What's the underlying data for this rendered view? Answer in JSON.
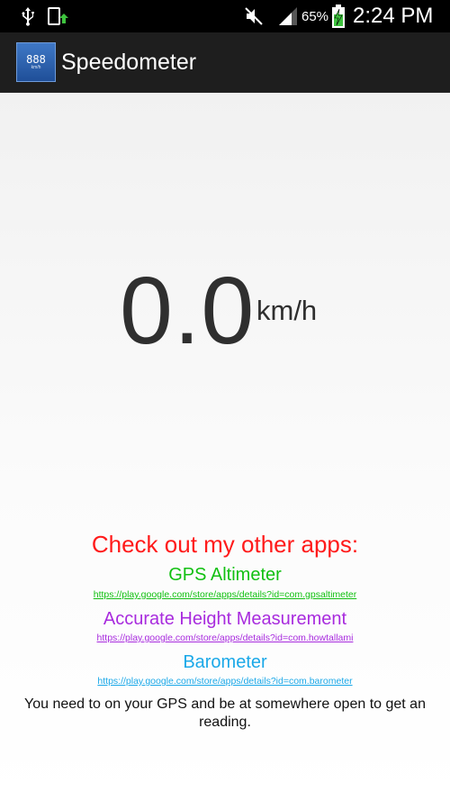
{
  "status_bar": {
    "battery": "65%",
    "time": "2:24 PM",
    "icons": [
      "usb-icon",
      "sync-icon",
      "mute-icon",
      "signal-icon",
      "battery-charging-icon"
    ]
  },
  "action_bar": {
    "icon_digits": "888",
    "icon_unit": "km/h",
    "title": "Speedometer"
  },
  "speedometer": {
    "value": "0.0",
    "unit": "km/h"
  },
  "promo": {
    "heading": "Check out my other apps:",
    "heading_color": "#ff1a1a",
    "apps": [
      {
        "name": "GPS Altimeter",
        "url": "https://play.google.com/store/apps/details?id=com.gpsaltimeter",
        "color": "#11c011"
      },
      {
        "name": "Accurate Height Measurement",
        "url": "https://play.google.com/store/apps/details?id=com.howtallami",
        "color": "#a82bde"
      },
      {
        "name": "Barometer",
        "url": "https://play.google.com/store/apps/details?id=com.barometer",
        "color": "#1aa8e8"
      }
    ]
  },
  "notice": "You need to on your GPS and be at somewhere open to get an reading."
}
